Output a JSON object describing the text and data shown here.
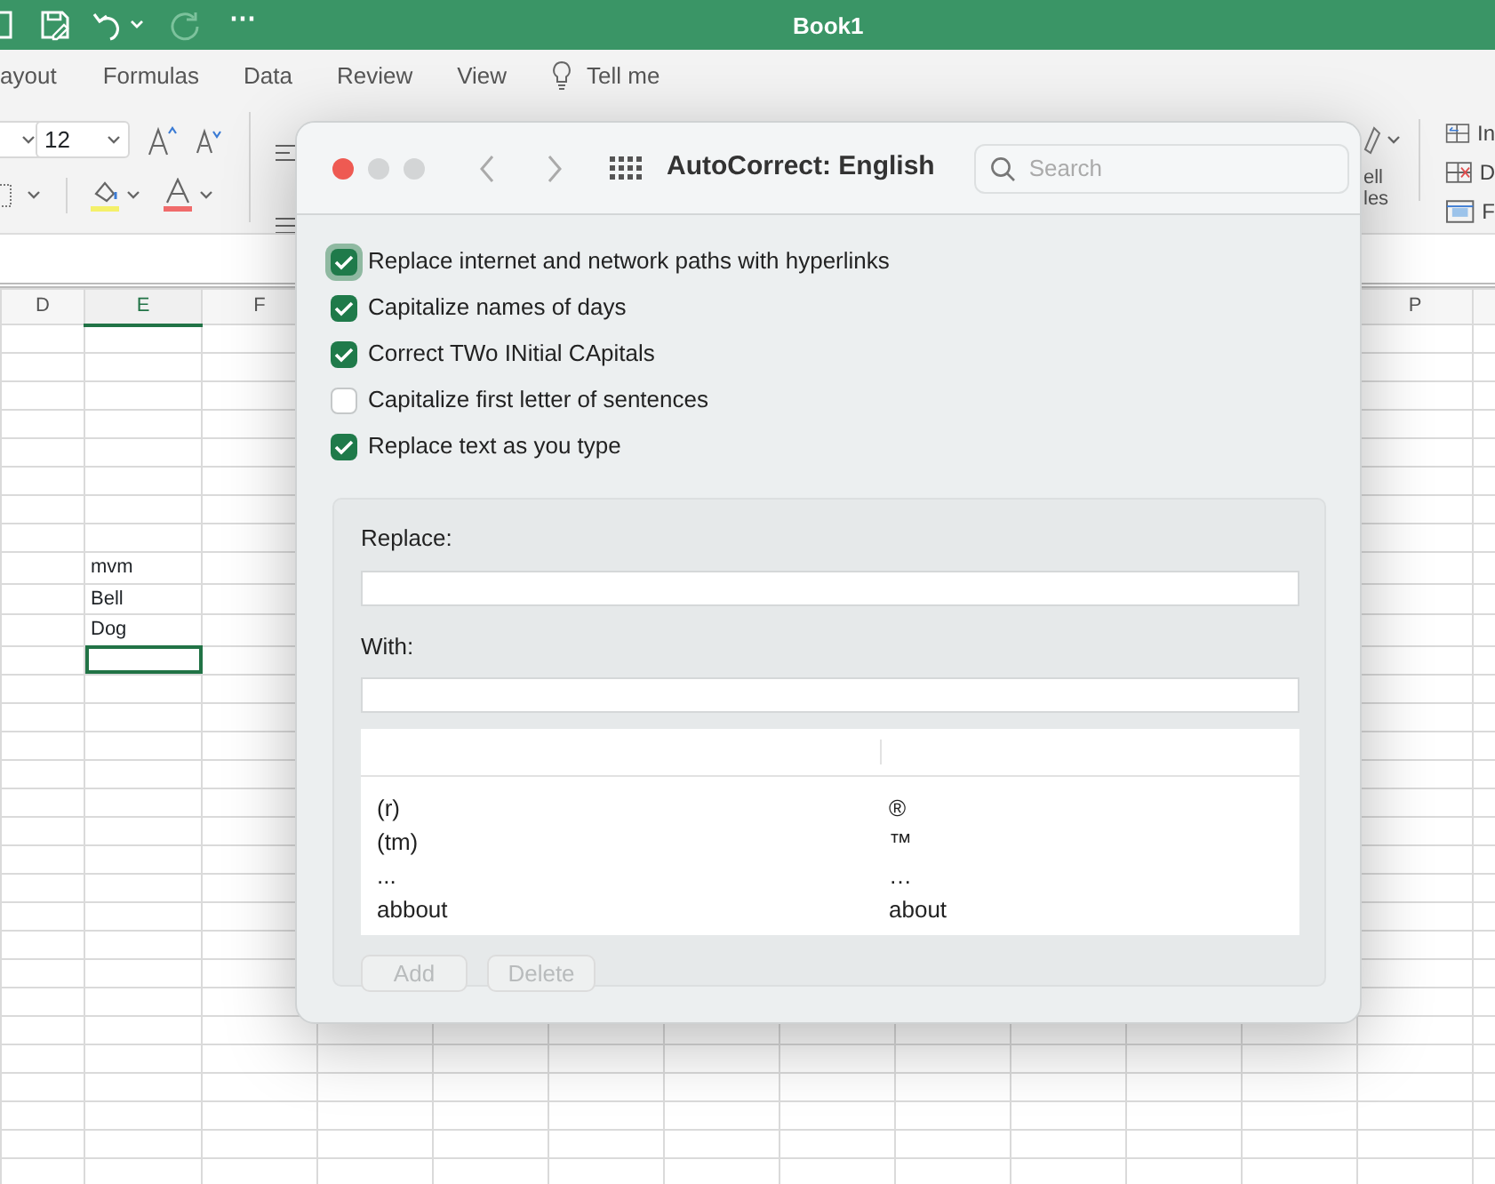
{
  "window": {
    "title": "Book1",
    "more": "⋯"
  },
  "ribbon_tabs": [
    {
      "label": "ayout",
      "kind": "tab"
    },
    {
      "label": "Formulas",
      "kind": "tab"
    },
    {
      "label": "Data",
      "kind": "tab"
    },
    {
      "label": "Review",
      "kind": "tab"
    },
    {
      "label": "View",
      "kind": "tab"
    },
    {
      "label": "Tell me",
      "kind": "search"
    }
  ],
  "ribbon": {
    "font_size": "12",
    "cell_styles_label": [
      "ell",
      "les"
    ],
    "cells_labels": [
      "In",
      "D",
      "F"
    ]
  },
  "sheet": {
    "columns": [
      {
        "label": "D",
        "selected": false
      },
      {
        "label": "E",
        "selected": true
      },
      {
        "label": "F",
        "selected": false
      },
      {
        "label": "P",
        "selected": false
      }
    ],
    "entries": [
      {
        "text": "mvm",
        "selected": false
      },
      {
        "text": "Bell",
        "selected": false
      },
      {
        "text": "Dog",
        "selected": false
      },
      {
        "selected": true
      }
    ]
  },
  "dialog": {
    "title": "AutoCorrect: English",
    "search": {
      "placeholder": "Search"
    },
    "options": [
      {
        "label": "Replace internet and network paths with hyperlinks",
        "checked": true,
        "focused": true
      },
      {
        "label": "Capitalize names of days",
        "checked": true,
        "focused": false
      },
      {
        "label": "Correct TWo INitial CApitals",
        "checked": true,
        "focused": false
      },
      {
        "label": "Capitalize first letter of sentences",
        "checked": false,
        "focused": false
      },
      {
        "label": "Replace text as you type",
        "checked": true,
        "focused": false
      }
    ],
    "replace_label": "Replace:",
    "with_label": "With:",
    "entries": [
      {
        "replace": "(r)",
        "with": "®"
      },
      {
        "replace": "(tm)",
        "with": "™"
      },
      {
        "replace": "...",
        "with": "…"
      },
      {
        "replace": "abbout",
        "with": "about"
      }
    ],
    "buttons": [
      {
        "label": "Add",
        "disabled": true
      },
      {
        "label": "Delete",
        "disabled": true
      }
    ]
  }
}
